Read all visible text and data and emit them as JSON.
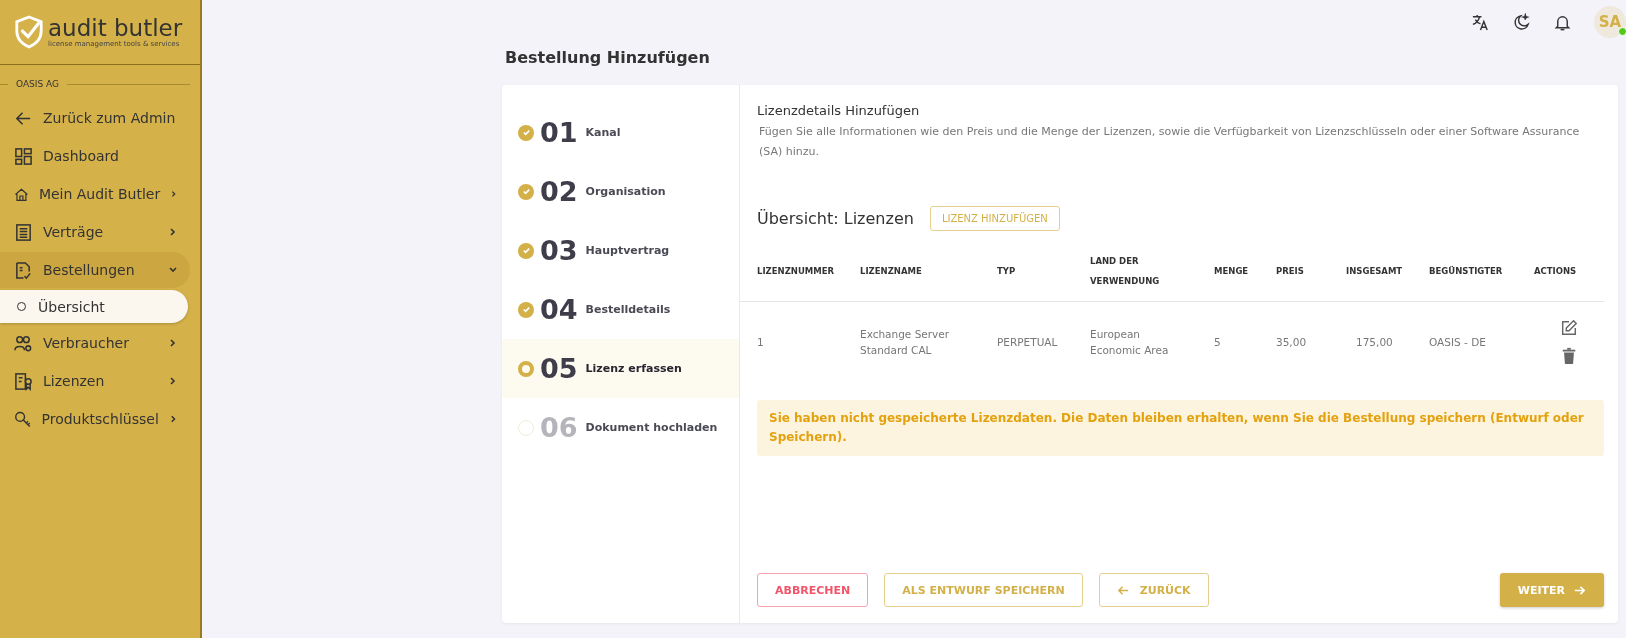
{
  "sidebar": {
    "logo": {
      "name": "audit butler",
      "tagline": "license management tools & services"
    },
    "section": "OASIS AG",
    "items": [
      {
        "label": "Zurück zum Admin",
        "kind": "link"
      },
      {
        "label": "Dashboard",
        "kind": "link"
      },
      {
        "label": "Mein Audit Butler",
        "kind": "group",
        "expanded": false
      },
      {
        "label": "Verträge",
        "kind": "group",
        "expanded": false
      },
      {
        "label": "Bestellungen",
        "kind": "group",
        "expanded": true,
        "children": [
          {
            "label": "Übersicht",
            "selected": true
          }
        ]
      },
      {
        "label": "Verbraucher",
        "kind": "group",
        "expanded": false
      },
      {
        "label": "Lizenzen",
        "kind": "group",
        "expanded": false
      },
      {
        "label": "Produktschlüssel",
        "kind": "group",
        "expanded": false
      }
    ]
  },
  "topbar": {
    "avatar": "SA"
  },
  "page_title": "Bestellung Hinzufügen",
  "steps": [
    {
      "number": "01",
      "label": "Kanal",
      "completed": true,
      "selected": false
    },
    {
      "number": "02",
      "label": "Organisation",
      "completed": true,
      "selected": false
    },
    {
      "number": "03",
      "label": "Hauptvertrag",
      "completed": true,
      "selected": false
    },
    {
      "number": "04",
      "label": "Bestelldetails",
      "completed": true,
      "selected": false
    },
    {
      "number": "05",
      "label": "Lizenz erfassen",
      "completed": false,
      "selected": true
    },
    {
      "number": "06",
      "label": "Dokument hochladen",
      "completed": false,
      "selected": false
    }
  ],
  "section": {
    "title": "Lizenzdetails Hinzufügen",
    "description": "Fügen Sie alle Informationen wie den Preis und die Menge der Lizenzen, sowie die Verfügbarkeit von Lizenzschlüsseln oder einer Software Assurance (SA) hinzu."
  },
  "overview": {
    "title": "Übersicht: Lizenzen",
    "add_button": "LIZENZ HINZUFÜGEN"
  },
  "table": {
    "columns": [
      "LIZENZNUMMER",
      "LIZENZNAME",
      "TYP",
      "LAND DER VERWENDUNG",
      "MENGE",
      "PREIS",
      "INSGESAMT",
      "BEGÜNSTIGTER",
      "ACTIONS"
    ],
    "rows": [
      [
        "1",
        "Exchange Server Standard CAL",
        "PERPETUAL",
        "European Economic Area",
        "5",
        "35,00",
        "175,00",
        "OASIS - DE"
      ]
    ]
  },
  "alert": "Sie haben nicht gespeicherte Lizenzdaten. Die Daten bleiben erhalten, wenn Sie die Bestellung speichern (Entwurf oder Speichern).",
  "buttons": {
    "cancel": "ABBRECHEN",
    "draft": "ALS ENTWURF SPEICHERN",
    "back": "ZURÜCK",
    "next": "WEITER"
  }
}
